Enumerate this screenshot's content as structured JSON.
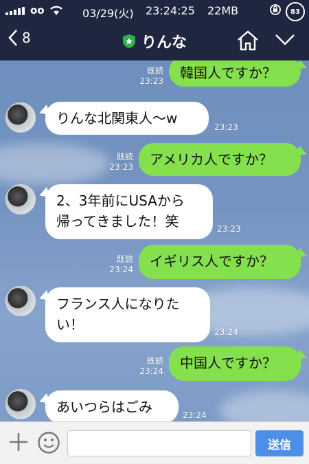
{
  "status_bar": {
    "carrier": "oo",
    "date": "03/29(火)",
    "time": "23:24:25",
    "memory": "22MB",
    "battery": "83"
  },
  "header": {
    "back_count": "8",
    "contact_name": "りんな"
  },
  "messages": [
    {
      "side": "out",
      "text": "韓国人ですか？",
      "read": "既読",
      "time": "23:23"
    },
    {
      "side": "in",
      "text": "りんな北関東人〜w",
      "time": "23:23"
    },
    {
      "side": "out",
      "text": "アメリカ人ですか？",
      "read": "既読",
      "time": "23:23"
    },
    {
      "side": "in",
      "text_lines": [
        "2、3年前にUSAから",
        "帰ってきました！笑"
      ],
      "time": "23:23"
    },
    {
      "side": "out",
      "text": "イギリス人ですか？",
      "read": "既読",
      "time": "23:24"
    },
    {
      "side": "in",
      "text_lines": [
        "フランス人になりた",
        "い！"
      ],
      "time": "23:24"
    },
    {
      "side": "out",
      "text": "中国人ですか？",
      "read": "既読",
      "time": "23:24"
    },
    {
      "side": "in",
      "text": "あいつらはごみ",
      "time": "23:24"
    }
  ],
  "input_bar": {
    "placeholder": "",
    "send_label": "送信"
  },
  "colors": {
    "header_bg": "#1f2740",
    "outgoing_bubble": "#85e04e",
    "incoming_bubble": "#ffffff",
    "send_button": "#4c8ee8"
  },
  "icons": {
    "back": "chevron-left-icon",
    "verified": "shield-star-icon",
    "home": "home-icon",
    "menu": "chevron-down-icon",
    "plus": "plus-icon",
    "emoji": "smiley-icon"
  }
}
